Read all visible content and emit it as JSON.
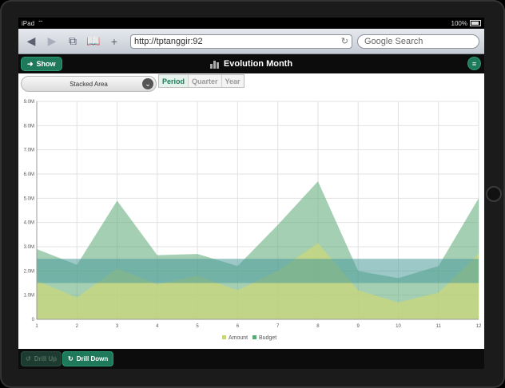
{
  "device": {
    "name": "iPad",
    "battery": "100%"
  },
  "browser": {
    "url": "http://tptanggir:92",
    "search_placeholder": "Google Search"
  },
  "toolbar": {
    "show_label": "Show",
    "title": "Evolution Month"
  },
  "controls": {
    "chart_type": "Stacked Area",
    "segments": [
      {
        "label": "Period",
        "active": true
      },
      {
        "label": "Quarter",
        "active": false
      },
      {
        "label": "Year",
        "active": false
      }
    ]
  },
  "footer": {
    "drill_up": "Drill Up",
    "drill_down": "Drill Down"
  },
  "chart_data": {
    "type": "area",
    "categories": [
      "1",
      "2",
      "3",
      "4",
      "5",
      "6",
      "7",
      "8",
      "9",
      "10",
      "11",
      "12"
    ],
    "y_ticks": [
      "0",
      "1.0M",
      "2.0M",
      "3.0M",
      "4.0M",
      "5.0M",
      "6.0M",
      "7.0M",
      "8.0M",
      "9.0M"
    ],
    "ylim": [
      0,
      9000000
    ],
    "grid": true,
    "legend_position": "bottom",
    "series": [
      {
        "name": "Amount",
        "color": "#c9d77a",
        "values": [
          1600000,
          900000,
          2100000,
          1450000,
          1800000,
          1200000,
          2000000,
          3150000,
          1200000,
          700000,
          1100000,
          2700000
        ]
      },
      {
        "name": "Budget",
        "color": "#5aa874",
        "values": [
          2900000,
          2250000,
          4900000,
          2650000,
          2700000,
          2200000,
          3900000,
          5700000,
          2000000,
          1700000,
          2200000,
          5000000
        ]
      }
    ],
    "budget_band": {
      "low": 1500000,
      "high": 2500000,
      "color": "#4a9b9b"
    }
  }
}
